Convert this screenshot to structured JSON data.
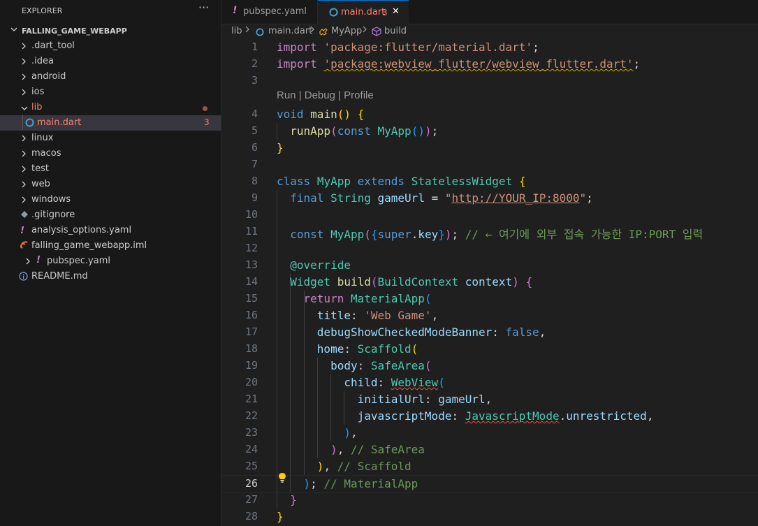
{
  "sidebar": {
    "title": "EXPLORER",
    "more_glyph": "···",
    "root_label": "FALLING_GAME_WEBAPP",
    "items": [
      {
        "label": ".dart_tool",
        "type": "folder"
      },
      {
        "label": ".idea",
        "type": "folder"
      },
      {
        "label": "android",
        "type": "folder"
      },
      {
        "label": "ios",
        "type": "folder"
      },
      {
        "label": "lib",
        "type": "folder-open"
      },
      {
        "label": "main.dart",
        "type": "file-dart",
        "badge": "3"
      },
      {
        "label": "linux",
        "type": "folder"
      },
      {
        "label": "macos",
        "type": "folder"
      },
      {
        "label": "test",
        "type": "folder"
      },
      {
        "label": "web",
        "type": "folder"
      },
      {
        "label": "windows",
        "type": "folder"
      },
      {
        "label": ".gitignore",
        "type": "file-git"
      },
      {
        "label": "analysis_options.yaml",
        "type": "file-yaml"
      },
      {
        "label": "falling_game_webapp.iml",
        "type": "file-iml"
      },
      {
        "label": "pubspec.yaml",
        "type": "file-yaml-collapsed"
      },
      {
        "label": "README.md",
        "type": "file-info"
      }
    ]
  },
  "tabs": [
    {
      "label": "pubspec.yaml",
      "icon": "yaml-icon"
    },
    {
      "label": "main.dart",
      "icon": "dart-icon",
      "badge": "3",
      "close": "✕"
    }
  ],
  "breadcrumb": {
    "folder": "lib",
    "file": "main.dart",
    "class": "MyApp",
    "method": "build"
  },
  "editor": {
    "codelens": "Run | Debug | Profile",
    "active_line": "26",
    "line_numbers": [
      "1",
      "2",
      "3",
      "4",
      "5",
      "6",
      "7",
      "8",
      "9",
      "10",
      "11",
      "12",
      "13",
      "14",
      "15",
      "16",
      "17",
      "18",
      "19",
      "20",
      "21",
      "22",
      "23",
      "24",
      "25",
      "26",
      "27",
      "28"
    ],
    "lines": [
      [
        [
          "c",
          "import"
        ],
        [
          "p",
          " "
        ],
        [
          "s",
          "'package:flutter/material.dart'"
        ],
        [
          "p",
          ";"
        ]
      ],
      [
        [
          "c",
          "import"
        ],
        [
          "p",
          " "
        ],
        [
          "s sq-y",
          "'package:webview_flutter/webview_flutter.dart'"
        ],
        [
          "p",
          ";"
        ]
      ],
      [],
      [
        [
          "k",
          "void"
        ],
        [
          "p",
          " "
        ],
        [
          "f",
          "main"
        ],
        [
          "b1",
          "()"
        ],
        [
          "p",
          " "
        ],
        [
          "b1",
          "{"
        ]
      ],
      [
        [
          "p",
          "  "
        ],
        [
          "f",
          "runApp"
        ],
        [
          "b2",
          "("
        ],
        [
          "k",
          "const"
        ],
        [
          "p",
          " "
        ],
        [
          "t",
          "MyApp"
        ],
        [
          "b3",
          "()"
        ],
        [
          "b2",
          ")"
        ],
        [
          "p",
          ";"
        ]
      ],
      [
        [
          "b1",
          "}"
        ]
      ],
      [],
      [
        [
          "k",
          "class"
        ],
        [
          "p",
          " "
        ],
        [
          "t",
          "MyApp"
        ],
        [
          "p",
          " "
        ],
        [
          "k",
          "extends"
        ],
        [
          "p",
          " "
        ],
        [
          "t",
          "StatelessWidget"
        ],
        [
          "p",
          " "
        ],
        [
          "b1",
          "{"
        ]
      ],
      [
        [
          "p",
          "  "
        ],
        [
          "k",
          "final"
        ],
        [
          "p",
          " "
        ],
        [
          "t",
          "String"
        ],
        [
          "p",
          " "
        ],
        [
          "v",
          "gameUrl"
        ],
        [
          "p",
          " = "
        ],
        [
          "s",
          "\""
        ],
        [
          "s ul",
          "http://YOUR_IP:8000"
        ],
        [
          "s",
          "\""
        ],
        [
          "p",
          ";"
        ]
      ],
      [],
      [
        [
          "p",
          "  "
        ],
        [
          "k",
          "const"
        ],
        [
          "p",
          " "
        ],
        [
          "t",
          "MyApp"
        ],
        [
          "b2",
          "("
        ],
        [
          "b3",
          "{"
        ],
        [
          "k",
          "super"
        ],
        [
          "p",
          "."
        ],
        [
          "v",
          "key"
        ],
        [
          "b3",
          "}"
        ],
        [
          "b2",
          ")"
        ],
        [
          "p",
          "; "
        ],
        [
          "cm",
          "// ← 여기에 외부 접속 가능한 IP:PORT 입력"
        ]
      ],
      [],
      [
        [
          "p",
          "  "
        ],
        [
          "t",
          "@override"
        ]
      ],
      [
        [
          "p",
          "  "
        ],
        [
          "t",
          "Widget"
        ],
        [
          "p",
          " "
        ],
        [
          "f",
          "build"
        ],
        [
          "b2",
          "("
        ],
        [
          "t",
          "BuildContext"
        ],
        [
          "p",
          " "
        ],
        [
          "v",
          "context"
        ],
        [
          "b2",
          ")"
        ],
        [
          "p",
          " "
        ],
        [
          "b2",
          "{"
        ]
      ],
      [
        [
          "p",
          "    "
        ],
        [
          "c",
          "return"
        ],
        [
          "p",
          " "
        ],
        [
          "t",
          "MaterialApp"
        ],
        [
          "b3",
          "("
        ]
      ],
      [
        [
          "p",
          "      "
        ],
        [
          "v",
          "title"
        ],
        [
          "p",
          ": "
        ],
        [
          "s",
          "'Web Game'"
        ],
        [
          "p",
          ","
        ]
      ],
      [
        [
          "p",
          "      "
        ],
        [
          "v",
          "debugShowCheckedModeBanner"
        ],
        [
          "p",
          ": "
        ],
        [
          "k",
          "false"
        ],
        [
          "p",
          ","
        ]
      ],
      [
        [
          "p",
          "      "
        ],
        [
          "v",
          "home"
        ],
        [
          "p",
          ": "
        ],
        [
          "t",
          "Scaffold"
        ],
        [
          "b1",
          "("
        ]
      ],
      [
        [
          "p",
          "        "
        ],
        [
          "v",
          "body"
        ],
        [
          "p",
          ": "
        ],
        [
          "t",
          "SafeArea"
        ],
        [
          "b2",
          "("
        ]
      ],
      [
        [
          "p",
          "          "
        ],
        [
          "v",
          "child"
        ],
        [
          "p",
          ": "
        ],
        [
          "t sq-r",
          "WebView"
        ],
        [
          "b3",
          "("
        ]
      ],
      [
        [
          "p",
          "            "
        ],
        [
          "v",
          "initialUrl"
        ],
        [
          "p",
          ": "
        ],
        [
          "v",
          "gameUrl"
        ],
        [
          "p",
          ","
        ]
      ],
      [
        [
          "p",
          "            "
        ],
        [
          "v",
          "javascriptMode"
        ],
        [
          "p",
          ": "
        ],
        [
          "t sq-r",
          "JavascriptMode"
        ],
        [
          "p",
          "."
        ],
        [
          "v",
          "unrestricted"
        ],
        [
          "p",
          ","
        ]
      ],
      [
        [
          "p",
          "          "
        ],
        [
          "b3",
          ")"
        ],
        [
          "p",
          ","
        ]
      ],
      [
        [
          "p",
          "        "
        ],
        [
          "b2",
          ")"
        ],
        [
          "p",
          ", "
        ],
        [
          "cm",
          "// SafeArea"
        ]
      ],
      [
        [
          "p",
          "      "
        ],
        [
          "b1",
          ")"
        ],
        [
          "p",
          ", "
        ],
        [
          "cm",
          "// Scaffold"
        ]
      ],
      [
        [
          "p",
          "    "
        ],
        [
          "b3",
          ")"
        ],
        [
          "p",
          "; "
        ],
        [
          "cm",
          "// MaterialApp"
        ]
      ],
      [
        [
          "p",
          "  "
        ],
        [
          "b2",
          "}"
        ]
      ],
      [
        [
          "b1",
          "}"
        ]
      ]
    ]
  }
}
